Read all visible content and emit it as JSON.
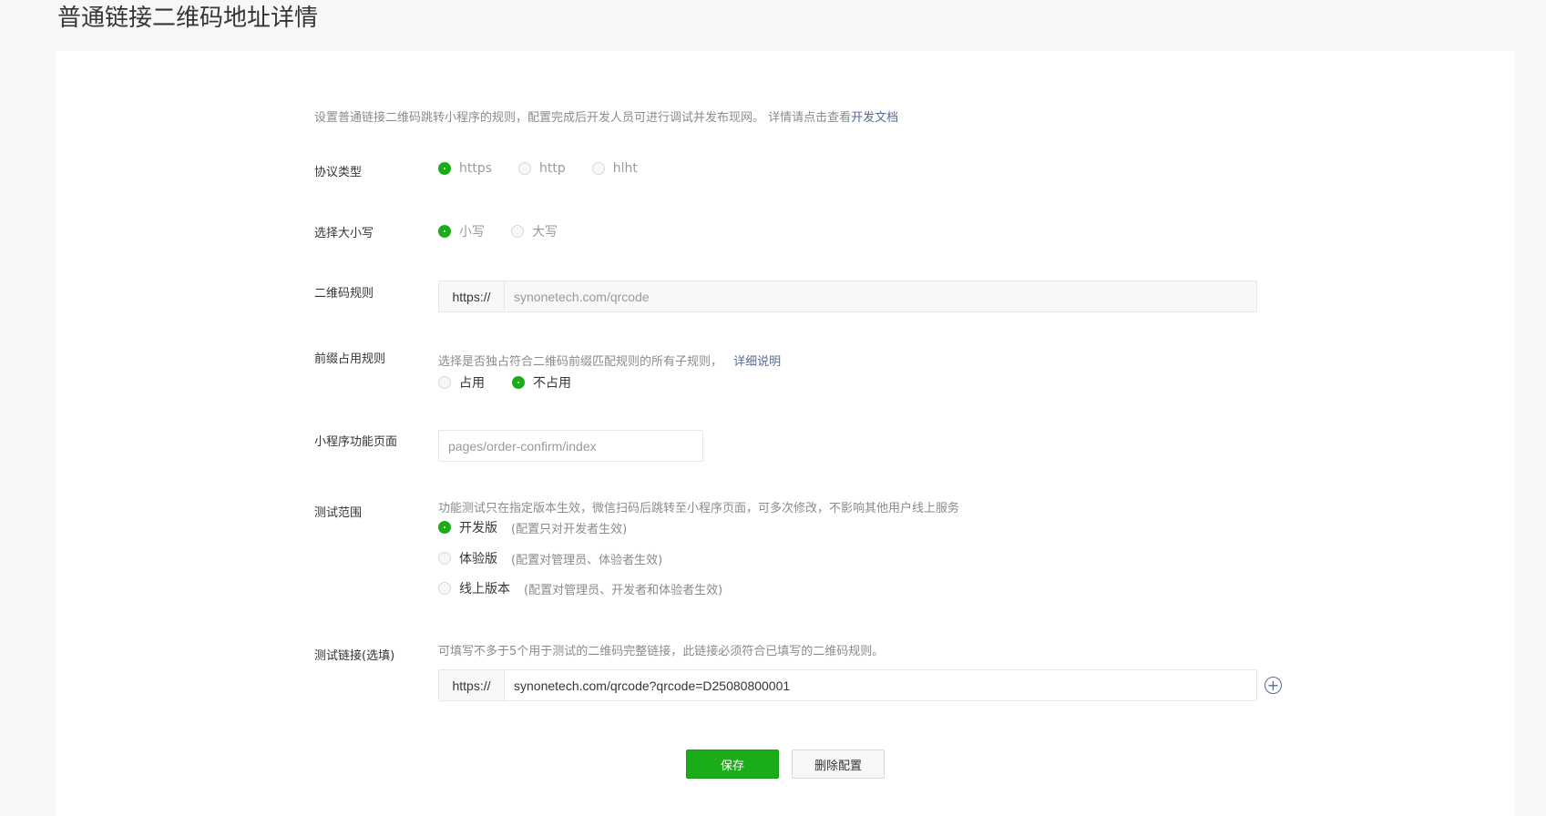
{
  "page": {
    "title": "普通链接二维码地址详情"
  },
  "intro": {
    "text": "设置普通链接二维码跳转小程序的规则，配置完成后开发人员可进行调试并发布现网。 详情请点击查看",
    "link": "开发文档"
  },
  "protocol": {
    "label": "协议类型",
    "options": [
      "https",
      "http",
      "hlht"
    ],
    "selected": "https"
  },
  "case": {
    "label": "选择大小写",
    "options": [
      "小写",
      "大写"
    ],
    "selected": "小写"
  },
  "qr_rule": {
    "label": "二维码规则",
    "prefix": "https://",
    "value": "synonetech.com/qrcode"
  },
  "prefix_rule": {
    "label": "前缀占用规则",
    "desc": "选择是否独占符合二维码前缀匹配规则的所有子规则，",
    "link": "详细说明",
    "options": [
      "占用",
      "不占用"
    ],
    "selected": "不占用"
  },
  "mini_page": {
    "label": "小程序功能页面",
    "value": "pages/order-confirm/index"
  },
  "test_scope": {
    "label": "测试范围",
    "desc": "功能测试只在指定版本生效，微信扫码后跳转至小程序页面，可多次修改，不影响其他用户线上服务",
    "options": [
      {
        "name": "开发版",
        "note": "(配置只对开发者生效)"
      },
      {
        "name": "体验版",
        "note": "(配置对管理员、体验者生效)"
      },
      {
        "name": "线上版本",
        "note": "(配置对管理员、开发者和体验者生效)"
      }
    ],
    "selected": "开发版"
  },
  "test_link": {
    "label": "测试链接(选填)",
    "desc": "可填写不多于5个用于测试的二维码完整链接，此链接必须符合已填写的二维码规则。",
    "prefix": "https://",
    "value": "synonetech.com/qrcode?qrcode=D25080800001",
    "add_icon": "plus-circle-icon"
  },
  "actions": {
    "save": "保存",
    "delete": "删除配置"
  },
  "colors": {
    "accent": "#1aad19",
    "link": "#576b95",
    "background": "#f6f7f8"
  }
}
